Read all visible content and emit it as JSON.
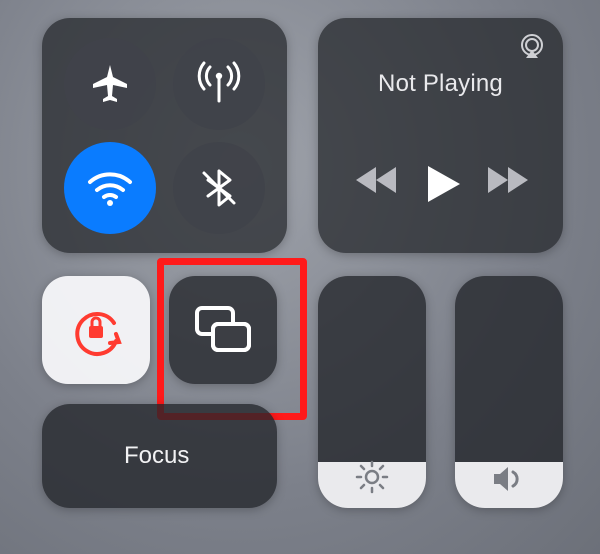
{
  "connectivity": {
    "airplane": {
      "name": "airplane-mode-toggle",
      "icon": "airplane-icon",
      "active": false
    },
    "cellular": {
      "name": "cellular-data-toggle",
      "icon": "antenna-icon",
      "active": false
    },
    "wifi": {
      "name": "wifi-toggle",
      "icon": "wifi-icon",
      "active": true
    },
    "bluetooth": {
      "name": "bluetooth-toggle",
      "icon": "bluetooth-off-icon",
      "active": false
    }
  },
  "media": {
    "status_label": "Not Playing",
    "airplay": {
      "name": "airplay-indicator",
      "icon": "airplay-icon"
    },
    "rewind": {
      "name": "rewind-button",
      "icon": "rewind-icon"
    },
    "play": {
      "name": "play-button",
      "icon": "play-icon"
    },
    "forward": {
      "name": "forward-button",
      "icon": "forward-icon"
    }
  },
  "tiles": {
    "rotation_lock": {
      "name": "rotation-lock-toggle",
      "icon": "rotation-lock-icon",
      "active": true,
      "accent": "#ff3b30"
    },
    "screen_mirroring": {
      "name": "screen-mirroring-button",
      "icon": "screen-mirroring-icon",
      "highlighted": true
    }
  },
  "focus": {
    "name": "focus-toggle",
    "icon": "moon-icon",
    "label": "Focus",
    "active": false
  },
  "sliders": {
    "brightness": {
      "name": "brightness-slider",
      "icon": "sun-icon",
      "level_pct": 20
    },
    "volume": {
      "name": "volume-slider",
      "icon": "speaker-icon",
      "level_pct": 20
    }
  },
  "colors": {
    "tile_dark": "#232529",
    "tile_light": "#fafafc",
    "accent_blue": "#0a7cff",
    "alert_red": "#ff3b30",
    "highlight": "#ff1a1a"
  }
}
